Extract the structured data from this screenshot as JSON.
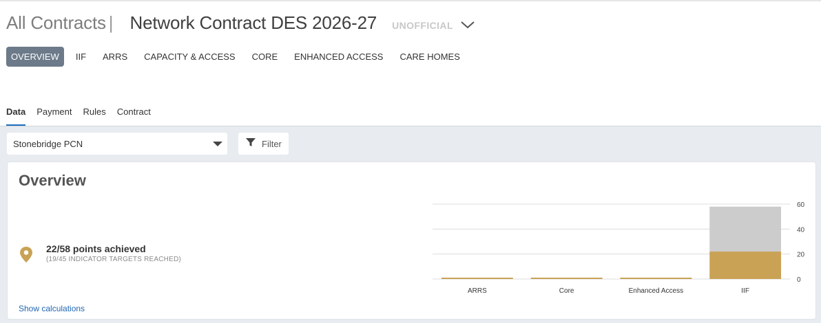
{
  "header": {
    "all_contracts": "All Contracts",
    "separator": "|",
    "contract_title": "Network Contract DES 2026-27",
    "status_badge": "UNOFFICIAL"
  },
  "nav_tabs": [
    {
      "label": "OVERVIEW",
      "active": true
    },
    {
      "label": "IIF",
      "active": false
    },
    {
      "label": "ARRS",
      "active": false
    },
    {
      "label": "CAPACITY & ACCESS",
      "active": false
    },
    {
      "label": "CORE",
      "active": false
    },
    {
      "label": "ENHANCED ACCESS",
      "active": false
    },
    {
      "label": "CARE HOMES",
      "active": false
    }
  ],
  "sub_tabs": [
    {
      "label": "Data",
      "active": true
    },
    {
      "label": "Payment",
      "active": false
    },
    {
      "label": "Rules",
      "active": false
    },
    {
      "label": "Contract",
      "active": false
    }
  ],
  "pcn_select": {
    "value": "Stonebridge PCN"
  },
  "filter_button": {
    "label": "Filter"
  },
  "overview": {
    "title": "Overview",
    "points_main": "22/58 points achieved",
    "points_sub": "(19/45 INDICATOR TARGETS REACHED)",
    "show_calculations": "Show calculations"
  },
  "colors": {
    "accent_tab": "#6c7a89",
    "achieved": "#c9a256",
    "remaining": "#cccccc",
    "link": "#1f66b3",
    "pin": "#c9a256"
  },
  "chart_data": {
    "type": "bar",
    "stacked": true,
    "categories": [
      "ARRS",
      "Core",
      "Enhanced Access",
      "IIF"
    ],
    "series": [
      {
        "key": "achieved",
        "values": [
          0,
          0,
          0,
          22
        ],
        "color": "#c9a256"
      },
      {
        "key": "remaining",
        "values": [
          0,
          0,
          0,
          36
        ],
        "color": "#cccccc"
      }
    ],
    "ylim": [
      0,
      60
    ],
    "yticks": [
      0,
      20,
      40,
      60
    ],
    "y_axis_side": "right",
    "grid": true,
    "legend": "none"
  }
}
